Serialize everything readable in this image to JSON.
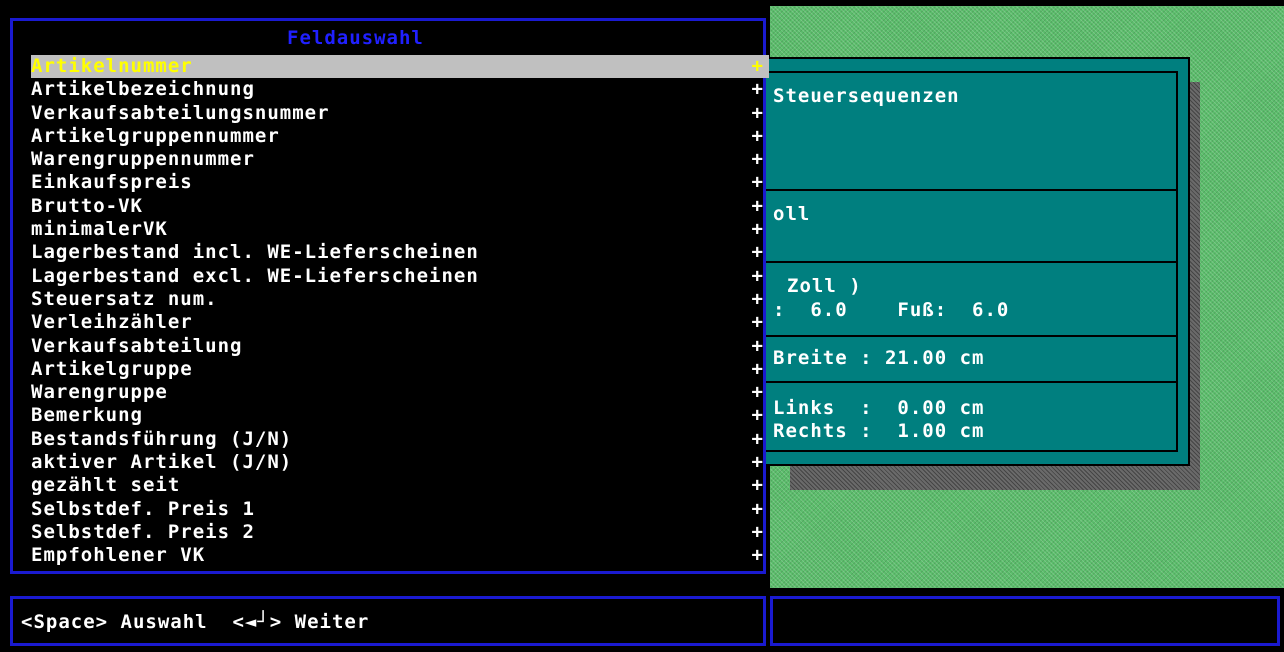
{
  "panel": {
    "title": "Feldauswahl",
    "items": [
      {
        "label": "Artikelnummer",
        "marker": "+",
        "selected": true
      },
      {
        "label": "Artikelbezeichnung",
        "marker": "+"
      },
      {
        "label": "Verkaufsabteilungsnummer",
        "marker": "+"
      },
      {
        "label": "Artikelgruppennummer",
        "marker": "+"
      },
      {
        "label": "Warengruppennummer",
        "marker": "+"
      },
      {
        "label": "Einkaufspreis",
        "marker": "+"
      },
      {
        "label": "Brutto-VK",
        "marker": "+"
      },
      {
        "label": "minimalerVK",
        "marker": "+"
      },
      {
        "label": "Lagerbestand incl. WE-Lieferscheinen",
        "marker": "+"
      },
      {
        "label": "Lagerbestand excl. WE-Lieferscheinen",
        "marker": "+"
      },
      {
        "label": "Steuersatz num.",
        "marker": "+"
      },
      {
        "label": "Verleihzähler",
        "marker": "+"
      },
      {
        "label": "Verkaufsabteilung",
        "marker": "+"
      },
      {
        "label": "Artikelgruppe",
        "marker": "+"
      },
      {
        "label": "Warengruppe",
        "marker": "+"
      },
      {
        "label": "Bemerkung",
        "marker": "+"
      },
      {
        "label": "Bestandsführung (J/N)",
        "marker": "+"
      },
      {
        "label": "aktiver Artikel (J/N)",
        "marker": "+"
      },
      {
        "label": "gezählt seit",
        "marker": "+"
      },
      {
        "label": "Selbstdef. Preis 1",
        "marker": "+"
      },
      {
        "label": "Selbstdef. Preis 2",
        "marker": "+"
      },
      {
        "label": "Empfohlener VK",
        "marker": "+"
      }
    ]
  },
  "background_dialog": {
    "line1": "Steuersequenzen",
    "line2": "oll",
    "line3": "Zoll )",
    "line4": ":  6.0    Fuß:  6.0",
    "line5": "Breite : 21.00 cm",
    "line6": "Links  :  0.00 cm",
    "line7": "Rechts :  1.00 cm"
  },
  "statusbar": {
    "hint": "<Space> Auswahl  <◄┘> Weiter"
  },
  "colors": {
    "window_border": "#1a1ad0",
    "title": "#2020ff",
    "selection_bg": "#c0c0c0",
    "selection_fg": "#ffff00",
    "dialog_bg": "#007f7f",
    "desktop": "#5bbd6b"
  }
}
